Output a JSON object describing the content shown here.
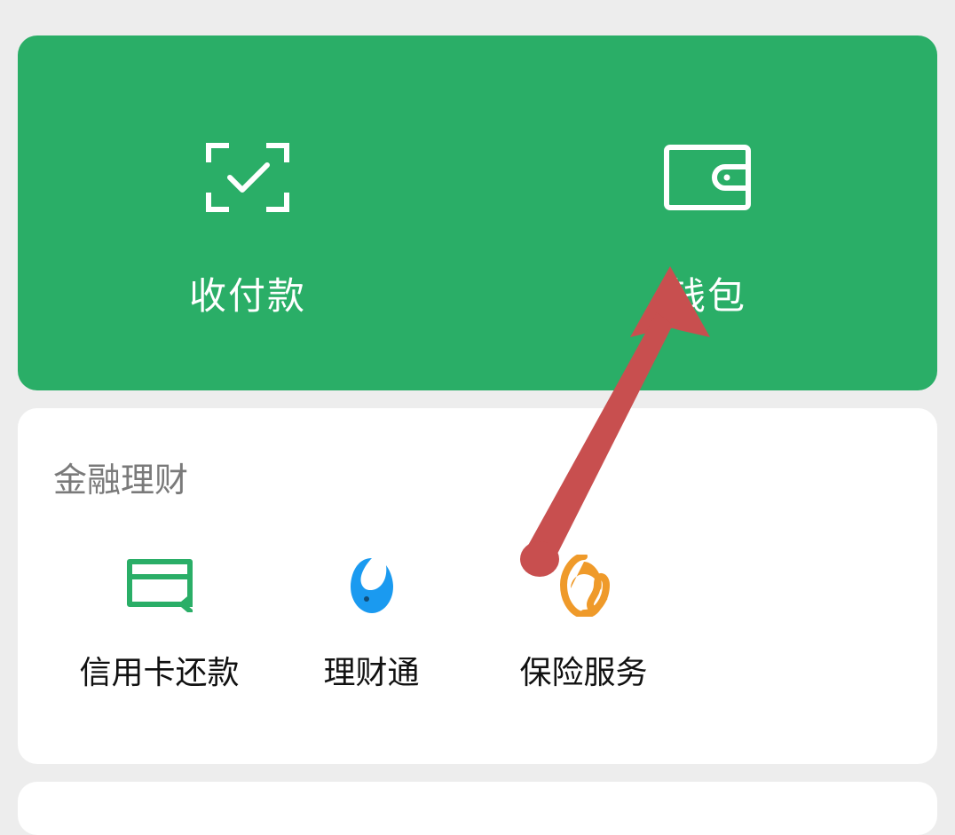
{
  "colors": {
    "accent_green": "#2aae67",
    "arrow": "#c84f4f",
    "licaitong": "#1a9af0",
    "insurance": "#ef9a2a"
  },
  "top": {
    "pay": {
      "label": "收付款",
      "icon": "scan-check-icon"
    },
    "wallet": {
      "label": "钱包",
      "icon": "wallet-icon"
    }
  },
  "finance": {
    "title": "金融理财",
    "items": [
      {
        "label": "信用卡还款",
        "icon": "credit-card-icon"
      },
      {
        "label": "理财通",
        "icon": "licaitong-icon"
      },
      {
        "label": "保险服务",
        "icon": "insurance-icon"
      }
    ]
  }
}
